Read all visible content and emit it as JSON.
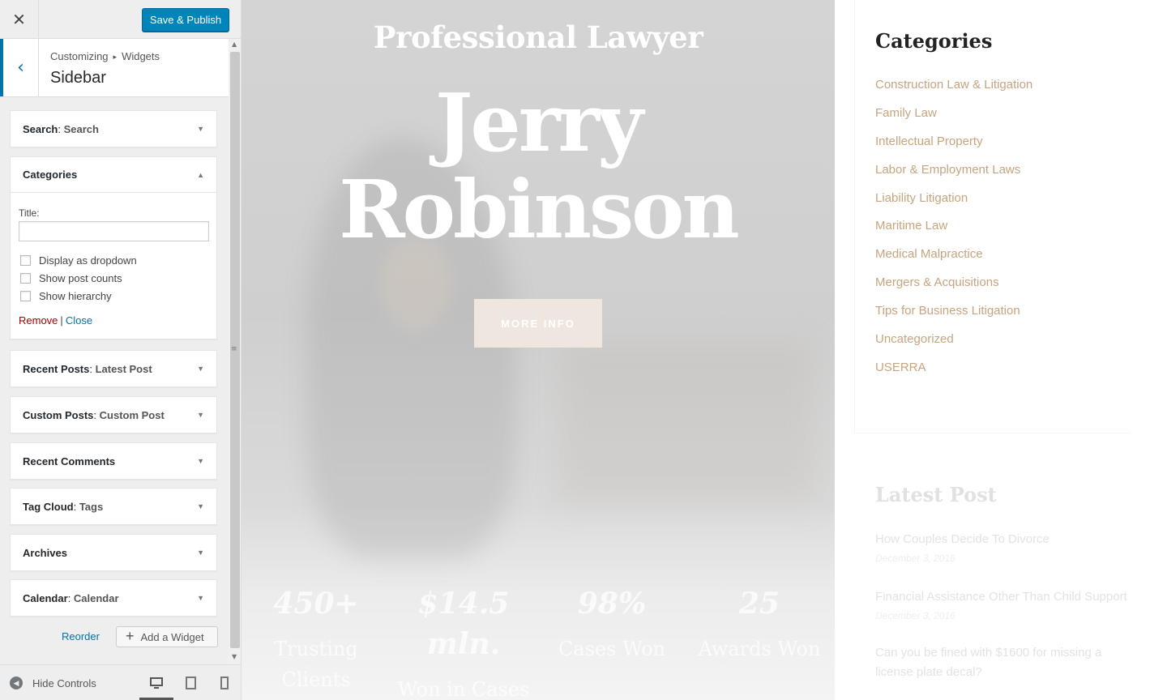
{
  "panel": {
    "close_glyph": "✕",
    "save_label": "Save & Publish",
    "breadcrumb": [
      "Customizing",
      "Widgets"
    ],
    "breadcrumb_sep": "▸",
    "section_title": "Sidebar"
  },
  "widgets": [
    {
      "name": "Search",
      "sub": "Search"
    },
    {
      "name": "Categories",
      "sub": ""
    },
    {
      "name": "Recent Posts",
      "sub": "Latest Post"
    },
    {
      "name": "Custom Posts",
      "sub": "Custom Post"
    },
    {
      "name": "Recent Comments",
      "sub": ""
    },
    {
      "name": "Tag Cloud",
      "sub": "Tags"
    },
    {
      "name": "Archives",
      "sub": ""
    },
    {
      "name": "Calendar",
      "sub": "Calendar"
    }
  ],
  "categories_form": {
    "title_label": "Title:",
    "title_value": "",
    "options": [
      "Display as dropdown",
      "Show post counts",
      "Show hierarchy"
    ],
    "remove_label": "Remove",
    "close_label": "Close"
  },
  "panel_actions": {
    "reorder_label": "Reorder",
    "add_widget_label": "Add a Widget"
  },
  "footer": {
    "hide_controls_label": "Hide Controls"
  },
  "hero": {
    "subtitle": "Professional Lawyer",
    "name_line1": "Jerry",
    "name_line2": "Robinson",
    "button_label": "MORE INFO",
    "stats": [
      {
        "num": "450+",
        "label": "Trusting Clients"
      },
      {
        "num": "$14.5 mln.",
        "label": "Won in Cases"
      },
      {
        "num": "98%",
        "label": "Cases Won"
      },
      {
        "num": "25",
        "label": "Awards Won"
      }
    ]
  },
  "sidebar_preview": {
    "categories_heading": "Categories",
    "categories": [
      "Construction Law & Litigation",
      "Family Law",
      "Intellectual Property",
      "Labor & Employment Laws",
      "Liability Litigation",
      "Maritime Law",
      "Medical Malpractice",
      "Mergers & Acquisitions",
      "Tips for Business Litigation",
      "Uncategorized",
      "USERRA"
    ],
    "latest_heading": "Latest Post",
    "posts": [
      {
        "title": "How Couples Decide To Divorce",
        "date": "December 3, 2016"
      },
      {
        "title": "Financial Assistance Other Than Child Support",
        "date": "December 3, 2016"
      },
      {
        "title": "Can you be fined with $1600 for missing a license plate decal?",
        "date": ""
      }
    ]
  },
  "colors": {
    "primary": "#0085ba",
    "link": "#0073aa",
    "remove": "#aa0000",
    "category_link": "#c6a47e"
  }
}
